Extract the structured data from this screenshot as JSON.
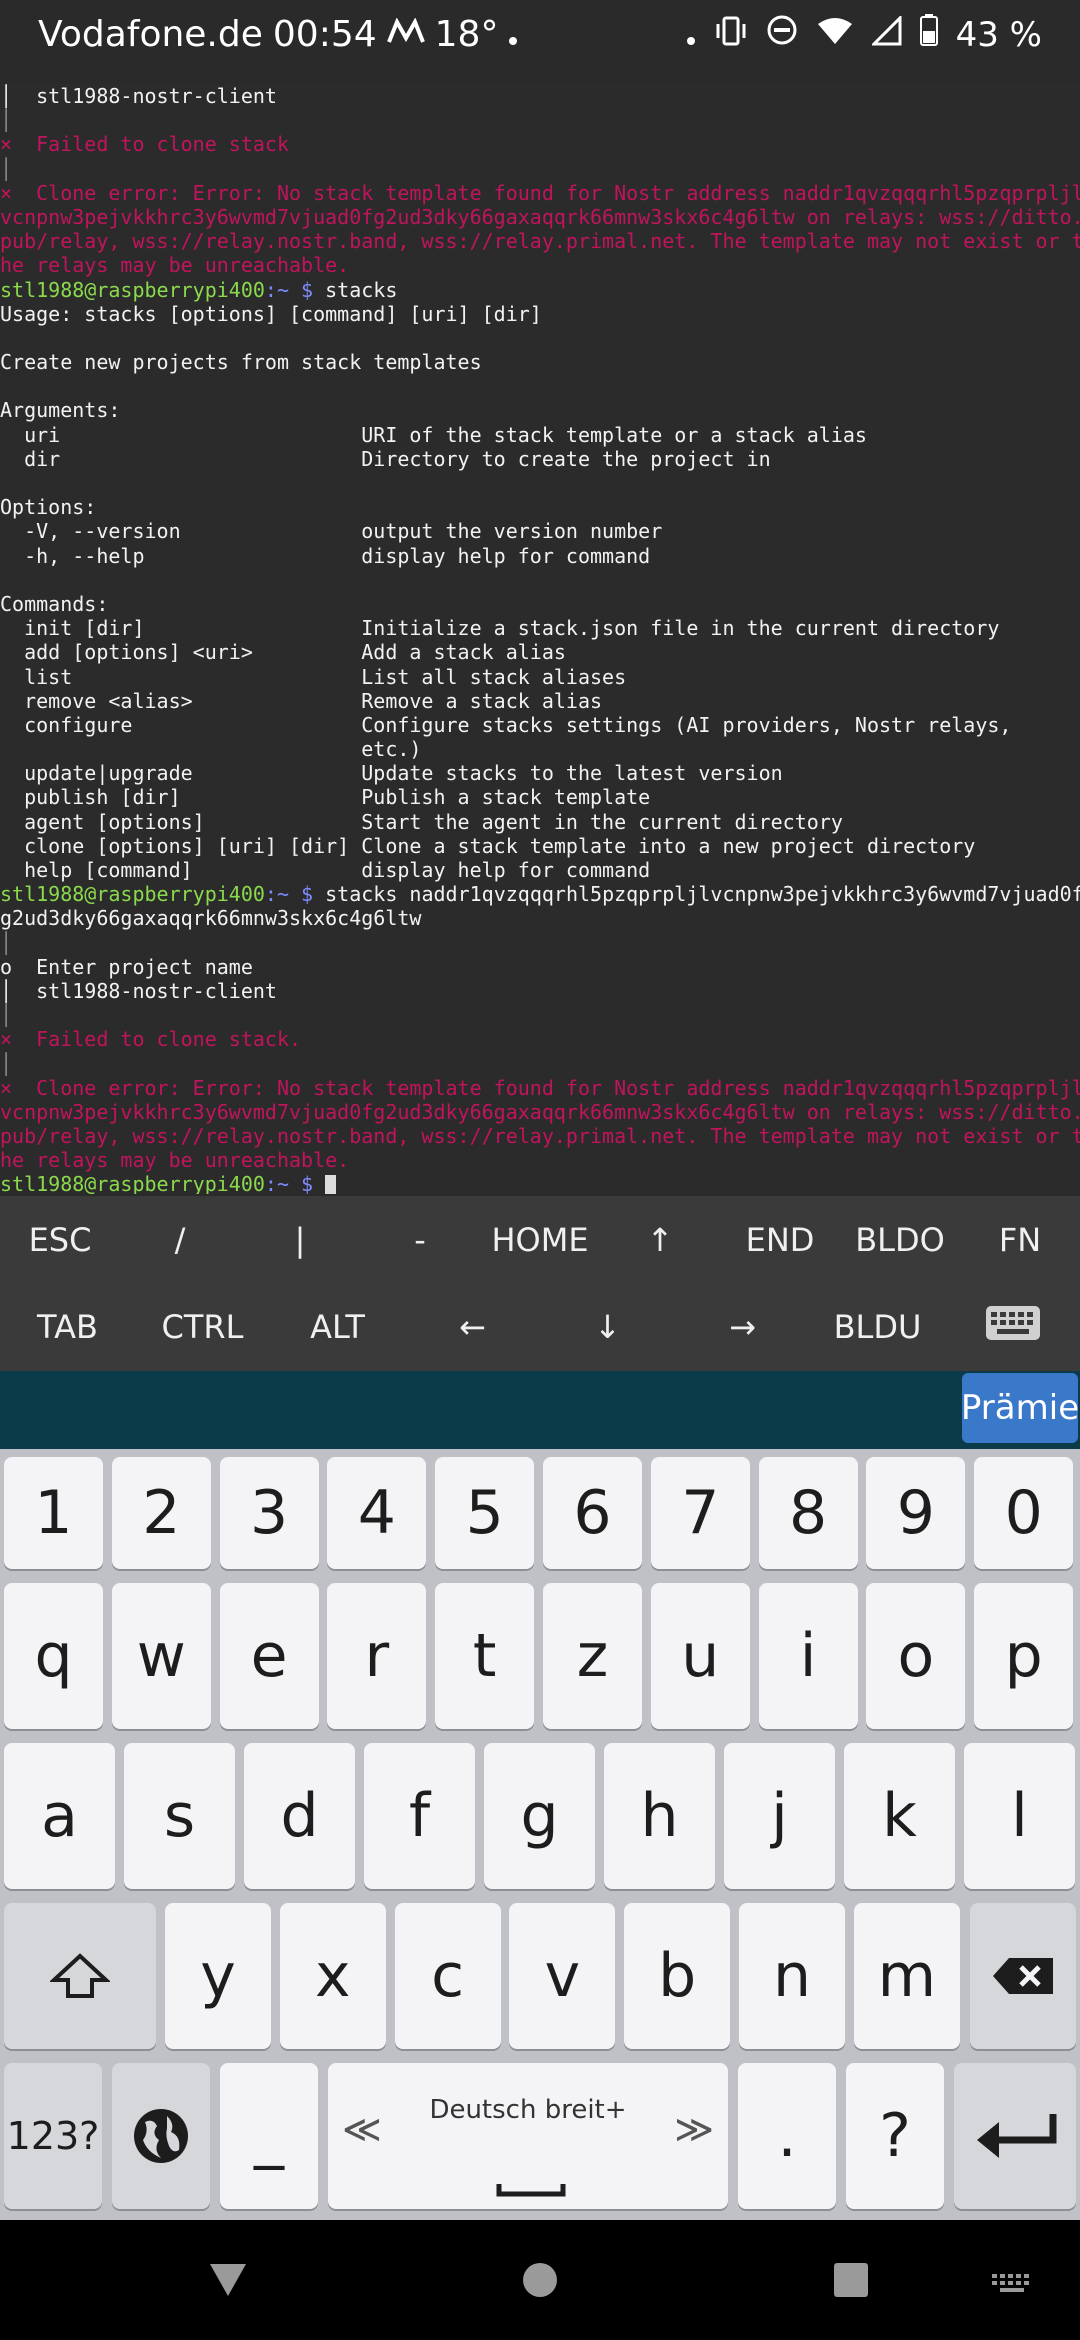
{
  "status": {
    "carrier": "Vodafone.de",
    "time": "00:54",
    "temp": "18°",
    "battery": "43 %"
  },
  "terminal": {
    "lines": [
      {
        "t": "│  stl1988-nostr-client",
        "c": ""
      },
      {
        "t": "│",
        "c": "muted"
      },
      {
        "t": "×  Failed to clone stack",
        "c": "err"
      },
      {
        "t": "│",
        "c": "muted"
      },
      {
        "t": "×  Clone error: Error: No stack template found for Nostr address naddr1qvzqqqrhl5pzqprpljl",
        "c": "err"
      },
      {
        "t": "vcnpnw3pejvkkhrc3y6wvmd7vjuad0fg2ud3dky66gaxaqqrk66mnw3skx6c4g6ltw on relays: wss://ditto.",
        "c": "err"
      },
      {
        "t": "pub/relay, wss://relay.nostr.band, wss://relay.primal.net. The template may not exist or t",
        "c": "err"
      },
      {
        "t": "he relays may be unreachable.",
        "c": "err"
      },
      {
        "t": "",
        "c": "prompt",
        "cmd": " stacks"
      },
      {
        "t": "Usage: stacks [options] [command] [uri] [dir]",
        "c": ""
      },
      {
        "t": "",
        "c": ""
      },
      {
        "t": "Create new projects from stack templates",
        "c": ""
      },
      {
        "t": "",
        "c": ""
      },
      {
        "t": "Arguments:",
        "c": ""
      },
      {
        "t": "  uri                         URI of the stack template or a stack alias",
        "c": ""
      },
      {
        "t": "  dir                         Directory to create the project in",
        "c": ""
      },
      {
        "t": "",
        "c": ""
      },
      {
        "t": "Options:",
        "c": ""
      },
      {
        "t": "  -V, --version               output the version number",
        "c": ""
      },
      {
        "t": "  -h, --help                  display help for command",
        "c": ""
      },
      {
        "t": "",
        "c": ""
      },
      {
        "t": "Commands:",
        "c": ""
      },
      {
        "t": "  init [dir]                  Initialize a stack.json file in the current directory",
        "c": ""
      },
      {
        "t": "  add [options] <uri>         Add a stack alias",
        "c": ""
      },
      {
        "t": "  list                        List all stack aliases",
        "c": ""
      },
      {
        "t": "  remove <alias>              Remove a stack alias",
        "c": ""
      },
      {
        "t": "  configure                   Configure stacks settings (AI providers, Nostr relays,",
        "c": ""
      },
      {
        "t": "                              etc.)",
        "c": ""
      },
      {
        "t": "  update|upgrade              Update stacks to the latest version",
        "c": ""
      },
      {
        "t": "  publish [dir]               Publish a stack template",
        "c": ""
      },
      {
        "t": "  agent [options]             Start the agent in the current directory",
        "c": ""
      },
      {
        "t": "  clone [options] [uri] [dir] Clone a stack template into a new project directory",
        "c": ""
      },
      {
        "t": "  help [command]              display help for command",
        "c": ""
      },
      {
        "t": "",
        "c": "prompt",
        "cmd": " stacks naddr1qvzqqqrhl5pzqprpljlvcnpnw3pejvkkhrc3y6wvmd7vjuad0f"
      },
      {
        "t": "g2ud3dky66gaxaqqrk66mnw3skx6c4g6ltw",
        "c": ""
      },
      {
        "t": "│",
        "c": "muted"
      },
      {
        "t": "o  Enter project name",
        "c": "name"
      },
      {
        "t": "│  stl1988-nostr-client",
        "c": ""
      },
      {
        "t": "│",
        "c": "muted"
      },
      {
        "t": "×  Failed to clone stack.",
        "c": "err"
      },
      {
        "t": "│",
        "c": "muted"
      },
      {
        "t": "×  Clone error: Error: No stack template found for Nostr address naddr1qvzqqqrhl5pzqprpljl",
        "c": "err"
      },
      {
        "t": "vcnpnw3pejvkkhrc3y6wvmd7vjuad0fg2ud3dky66gaxaqqrk66mnw3skx6c4g6ltw on relays: wss://ditto.",
        "c": "err"
      },
      {
        "t": "pub/relay, wss://relay.nostr.band, wss://relay.primal.net. The template may not exist or t",
        "c": "err"
      },
      {
        "t": "he relays may be unreachable.",
        "c": "err"
      },
      {
        "t": "",
        "c": "prompt-cursor",
        "cmd": " "
      }
    ],
    "prompt_user": "stl1988@raspberrypi400",
    "prompt_path": ":~ $"
  },
  "extra_keys": {
    "row1": [
      "ESC",
      "/",
      "|",
      "-",
      "HOME",
      "↑",
      "END",
      "BLDO",
      "FN"
    ],
    "row2": [
      "TAB",
      "CTRL",
      "ALT",
      "←",
      "↓",
      "→",
      "BLDU",
      "keyboard-icon"
    ]
  },
  "suggest": {
    "premium": "Prämie"
  },
  "keyboard": {
    "row_numbers": [
      "1",
      "2",
      "3",
      "4",
      "5",
      "6",
      "7",
      "8",
      "9",
      "0"
    ],
    "row_top": [
      "q",
      "w",
      "e",
      "r",
      "t",
      "z",
      "u",
      "i",
      "o",
      "p"
    ],
    "row_mid": [
      "a",
      "s",
      "d",
      "f",
      "g",
      "h",
      "j",
      "k",
      "l"
    ],
    "row_bottom": [
      "y",
      "x",
      "c",
      "v",
      "b",
      "n",
      "m"
    ],
    "mode_key": "123?",
    "underscore_key": "_",
    "space_label": "Deutsch breit+",
    "space_left": "≪",
    "space_right": "≫",
    "period_key": ".",
    "question_key": "?"
  }
}
